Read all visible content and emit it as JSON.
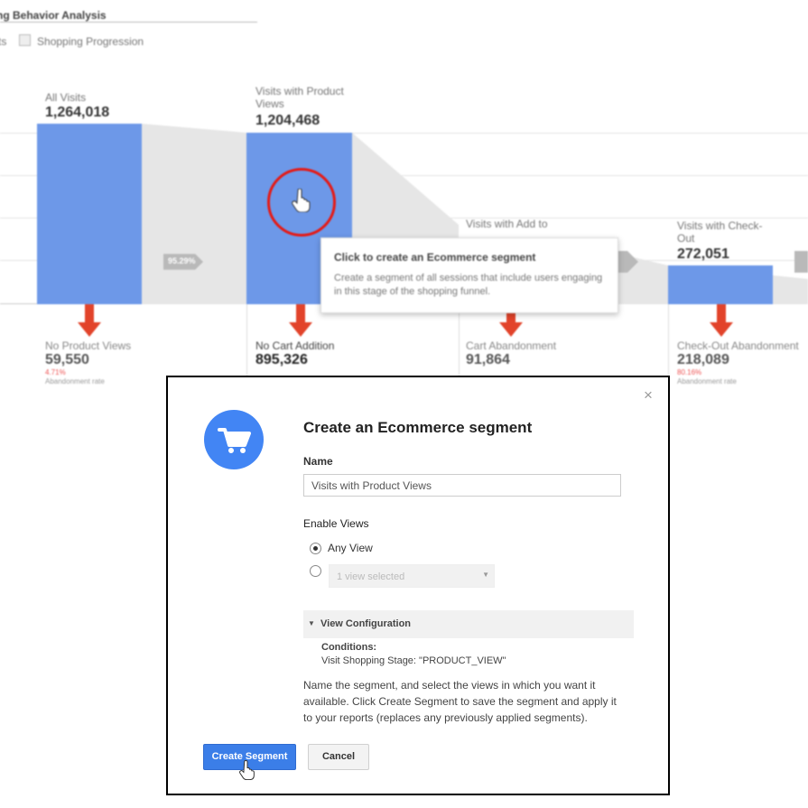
{
  "report": {
    "title": "ng Behavior Analysis",
    "tab_partial": "ts",
    "tab_label": "Shopping Progression"
  },
  "colors": {
    "bar": "#6d98e8",
    "drop_arrow": "#e2432a",
    "accent": "#4285f4",
    "highlight": "#e41b17",
    "rate_red": "#ee5555"
  },
  "funnel": {
    "stages": [
      {
        "label": "All Visits",
        "value": "1,264,018"
      },
      {
        "label": "Visits with Product Views",
        "value": "1,204,468"
      },
      {
        "label": "Visits with Add to Basket",
        "value": ""
      },
      {
        "label": "Visits with Check-Out",
        "value": "272,051"
      }
    ],
    "stage3_label_line1": "Visits with Add to",
    "stage4_label_line1": "Visits with Check-",
    "stage4_label_line2": "Out",
    "stage2_label_line1": "Visits with Product",
    "stage2_label_line2": "Views",
    "bar_fill": [
      1.0,
      0.95,
      0.0,
      0.215
    ],
    "rate_tags": [
      "95.29%",
      "",
      ""
    ],
    "drops": [
      {
        "label": "No Product Views",
        "value": "59,550",
        "rate": "4.71%",
        "rate_label": "Abandonment rate"
      },
      {
        "label": "No Cart Addition",
        "value": "895,326",
        "rate": "",
        "rate_label": ""
      },
      {
        "label": "Cart Abandonment",
        "value": "91,864",
        "rate": "",
        "rate_label": ""
      },
      {
        "label": "Check-Out Abandonment",
        "value": "218,089",
        "rate": "80.16%",
        "rate_label": "Abandonment rate"
      }
    ]
  },
  "tooltip": {
    "title": "Click to create an Ecommerce segment",
    "body": "Create a segment of all sessions that include users engaging in this stage of the shopping funnel."
  },
  "dialog": {
    "title": "Create an Ecommerce segment",
    "close_symbol": "×",
    "name_label": "Name",
    "name_value": "Visits with Product Views",
    "enable_views_label": "Enable Views",
    "option_any_view": "Any View",
    "any_view_selected": true,
    "select_placeholder": "1 view selected",
    "config_header": "View Configuration",
    "conditions_label": "Conditions:",
    "conditions_value": "Visit Shopping Stage: \"PRODUCT_VIEW\"",
    "helper_text": "Name the segment, and select the views in which you want it available. Click Create Segment to save the segment and apply it to your reports (replaces any previously applied segments).",
    "create_button": "Create Segment",
    "cancel_button": "Cancel",
    "icon": "shopping-cart-icon"
  }
}
